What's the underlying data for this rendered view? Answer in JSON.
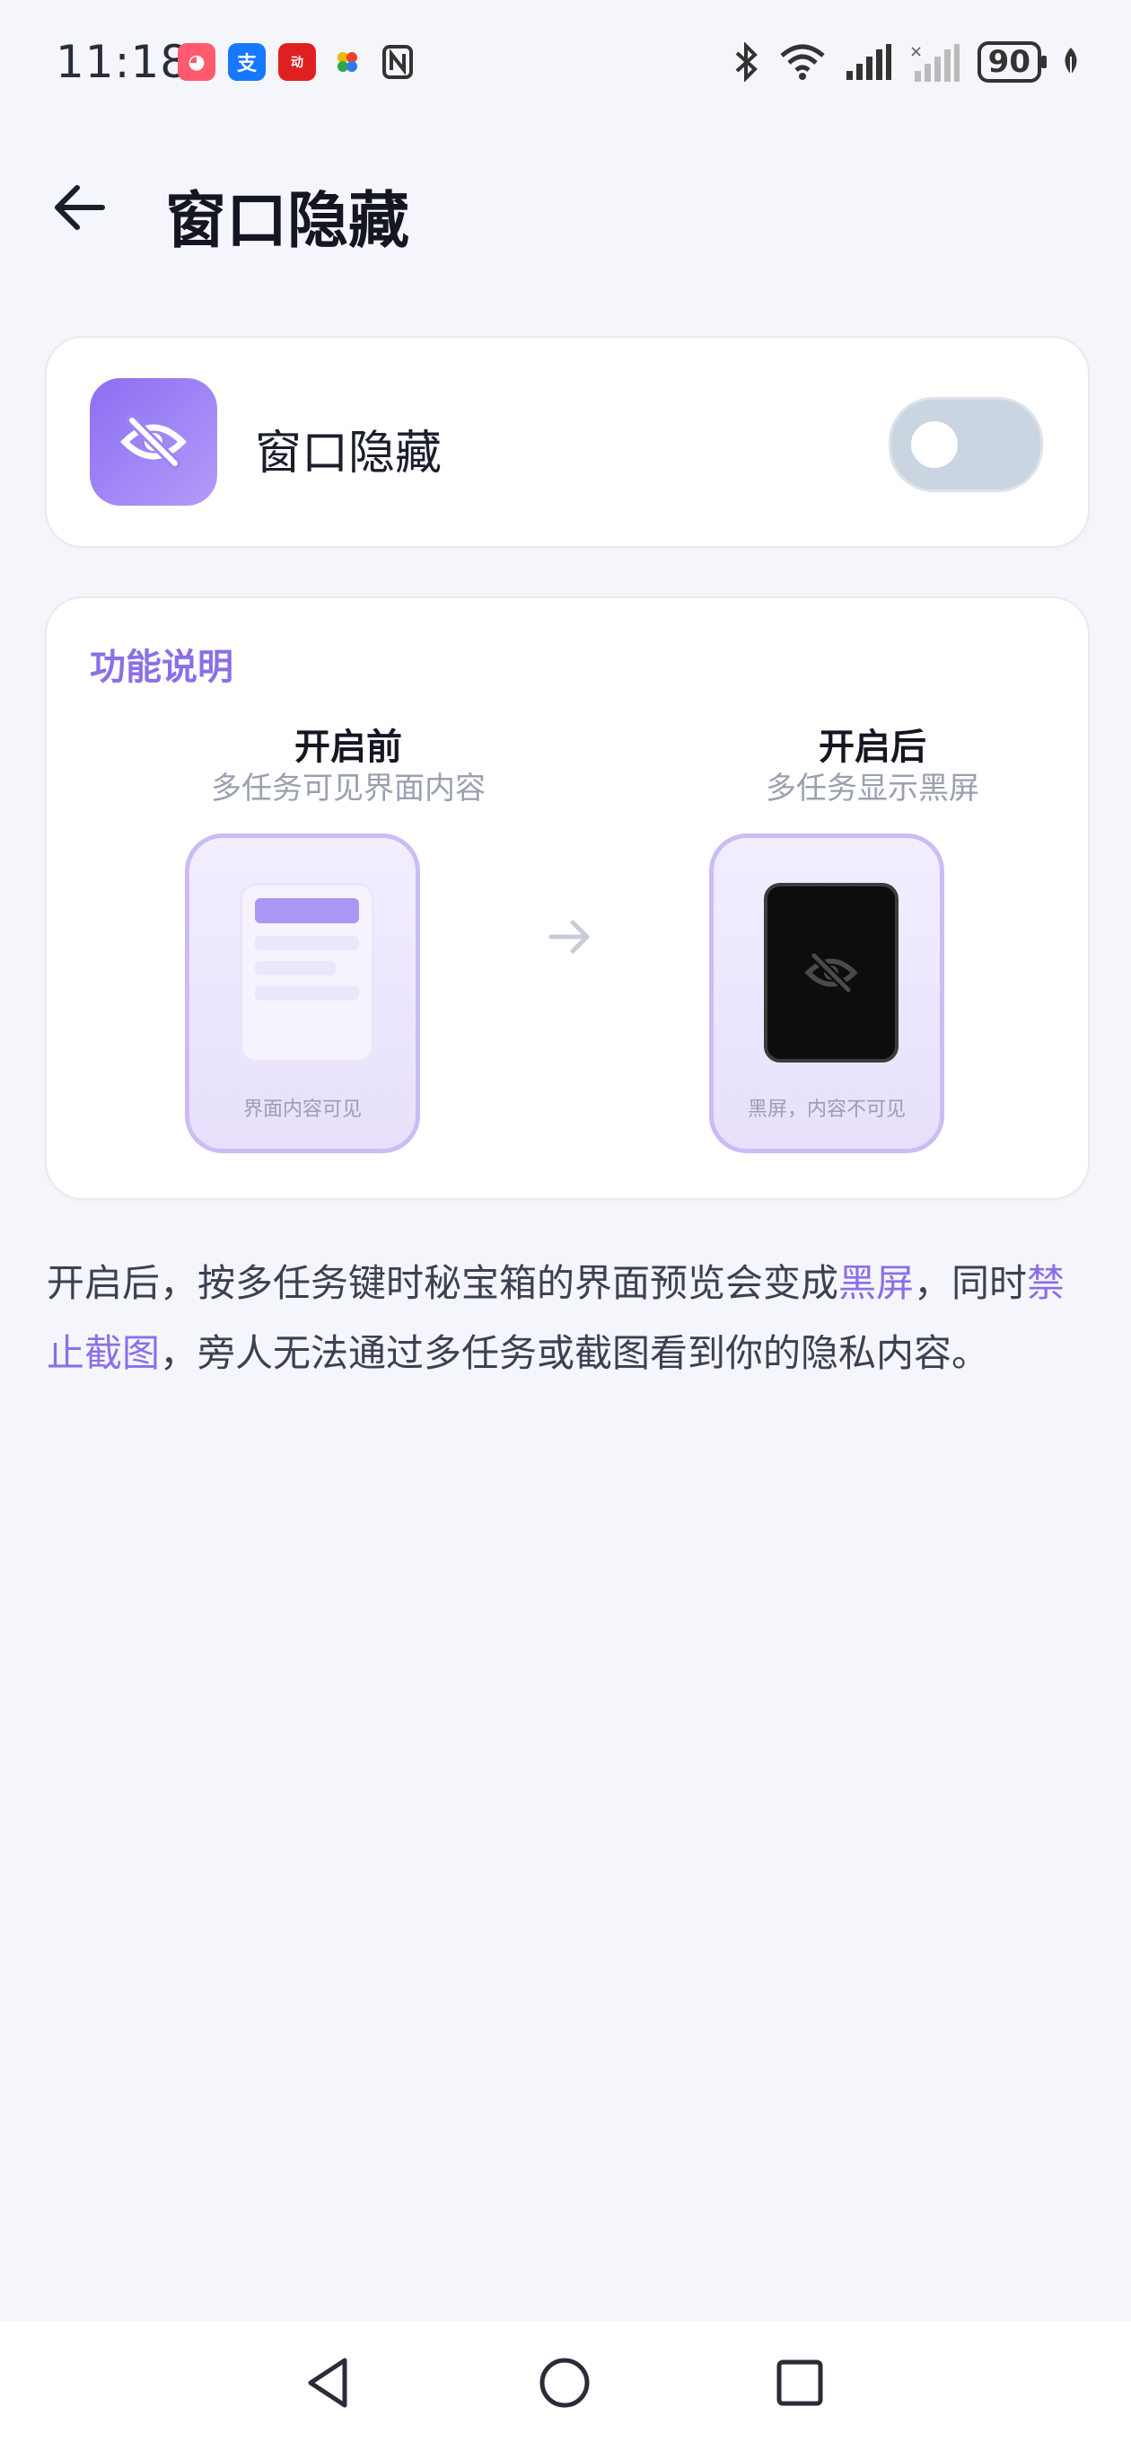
{
  "status_bar": {
    "time": "11:18",
    "battery_level": "90",
    "app_icons": [
      "app-icon-1",
      "alipay-icon",
      "app-icon-3",
      "app-icon-4",
      "nfc-icon"
    ],
    "system_icons": [
      "bluetooth-icon",
      "wifi-icon",
      "signal-icon",
      "signal-no-service-icon",
      "battery-icon",
      "leaf-icon"
    ]
  },
  "header": {
    "title": "窗口隐藏",
    "back_icon": "arrow-left-icon"
  },
  "toggle_card": {
    "label": "窗口隐藏",
    "icon": "eye-off-icon",
    "enabled": false
  },
  "explain_card": {
    "title": "功能说明",
    "before": {
      "title": "开启前",
      "subtitle": "多任务可见界面内容",
      "caption": "界面内容可见"
    },
    "after": {
      "title": "开启后",
      "subtitle": "多任务显示黑屏",
      "caption": "黑屏，内容不可见"
    }
  },
  "description": {
    "part1": "开启后，按多任务键时秘宝箱的界面预览会变成",
    "hl1": "黑屏",
    "part2": "，同时",
    "hl2": "禁止截图",
    "part3": "，旁人无法通过多任务或截图看到你的隐私内容。"
  },
  "colors": {
    "accent": "#8b6fe8",
    "toggle_off": "#cbd4e1",
    "background": "#f5f6fb"
  },
  "nav_bar": {
    "icons": [
      "back-triangle-icon",
      "home-circle-icon",
      "recents-square-icon"
    ]
  }
}
